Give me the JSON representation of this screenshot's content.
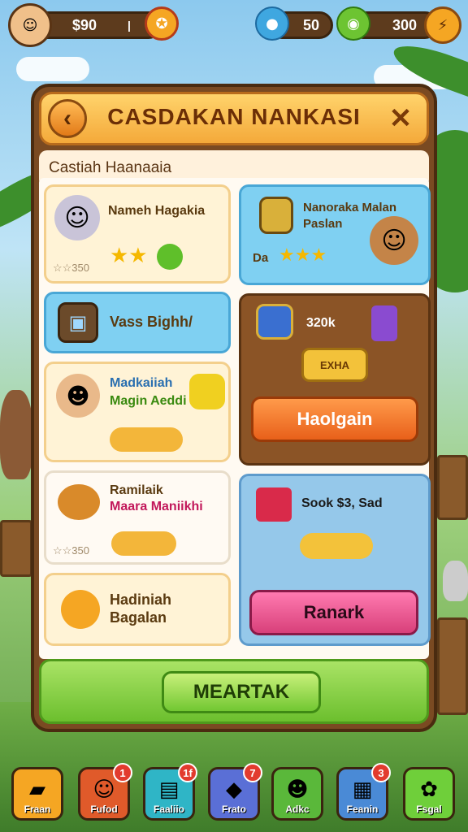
{
  "hud": {
    "coins": "$90",
    "gems": "50",
    "energy": "300"
  },
  "panel": {
    "title": "CASDAKAN NANKASI",
    "subtitle": "Castiah Haanaaia"
  },
  "cards": {
    "c1": {
      "title": "Nameh Hagakia",
      "price": "☆☆350"
    },
    "c2": {
      "title": "Vass Bighh/"
    },
    "c3": {
      "title1": "Madkaiiah",
      "title2": "Magin Aeddi"
    },
    "c4": {
      "title1": "Ramilaik",
      "title2": "Maara Maniikhi",
      "price": "☆☆350"
    },
    "c5": {
      "title1": "Hadiniah",
      "title2": "Bagalan"
    },
    "r1": {
      "title1": "Nanoraka Malan",
      "title2": "Paslan",
      "sub": "Da"
    },
    "r2": {
      "price": "320k",
      "ticket": "EXHA",
      "button": "Haolgain"
    },
    "r3": {
      "price": "Sook $3, Sad",
      "button": "Ranark"
    }
  },
  "main_button": "MEARTAK",
  "nav": [
    {
      "label": "Fraan",
      "icon": "box-icon",
      "badge": ""
    },
    {
      "label": "Fufod",
      "icon": "avatar-icon",
      "badge": "1"
    },
    {
      "label": "Faaliio",
      "icon": "card-icon",
      "badge": "1f"
    },
    {
      "label": "Frato",
      "icon": "cube-icon",
      "badge": "7"
    },
    {
      "label": "Adkc",
      "icon": "friend-icon",
      "badge": ""
    },
    {
      "label": "Feanin",
      "icon": "treasure-icon",
      "badge": "3"
    },
    {
      "label": "Fsgal",
      "icon": "leaf-icon",
      "badge": ""
    }
  ],
  "colors": {
    "accent": "#f4a93a",
    "primary_green": "#72c732",
    "orange_button": "#f0762a",
    "pink_button": "#e8508a"
  }
}
